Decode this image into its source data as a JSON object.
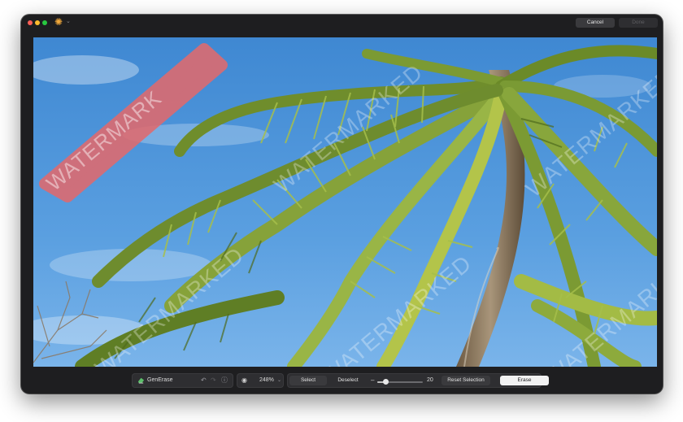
{
  "window": {
    "app_icon": "sparkle-icon",
    "cancel_label": "Cancel",
    "done_label": "Done"
  },
  "watermark_text": "WATERMARKED",
  "selection_highlight_text": "WATERMARK",
  "toolbar": {
    "tool_name": "GenErase",
    "tool_icon": "eraser-icon",
    "zoom_value": "248%",
    "select_label": "Select",
    "deselect_label": "Deselect",
    "brush_size": "20",
    "brush_slider_fraction": 0.18,
    "reset_label": "Reset Selection",
    "erase_label": "Erase"
  },
  "colors": {
    "accent_selection": "#e06a6e",
    "window_bg": "#1e1e20",
    "sky": "#4a8fd4"
  }
}
